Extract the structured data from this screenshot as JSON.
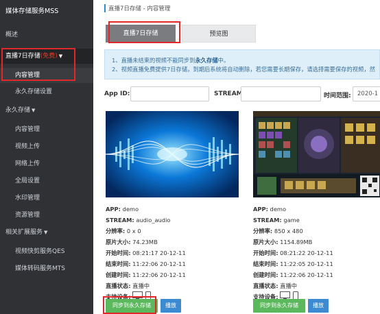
{
  "sidebar": {
    "brand": "媒体存储服务MSS",
    "overview": "概述",
    "live_group": {
      "label": "直播7日存储",
      "badge": "(免费)"
    },
    "content_mgmt": "内容管理",
    "permanent_settings": "永久存储设置",
    "perm_group": "永久存储",
    "perm_items": [
      "内容管理",
      "视频上传",
      "网络上传",
      "全局设置",
      "水印管理",
      "资源管理"
    ],
    "related_group": "相关扩展服务",
    "related_items": [
      "视频快剪服务QES",
      "媒体转码服务MTS"
    ]
  },
  "breadcrumb": "直播7日存储 - 内容管理",
  "tabs": {
    "live": "直播7日存储",
    "preview": "预览图"
  },
  "notice": {
    "line1_prefix": "1、直播未结束的视频不能同步到",
    "line1_bold": "永久存储",
    "line1_suffix": "中。",
    "line2": "2、视频直播免费提供7日存储，到期后系统将自动删除，若您需要长期保存，请选择需要保存的视频，然"
  },
  "filters": {
    "app_id_label": "App ID:",
    "stream_label": "STREAM:",
    "time_label": "时间范围:",
    "time_value": "2020-1"
  },
  "labels": {
    "app": "APP:",
    "stream": "STREAM:",
    "resolution": "分辨率:",
    "size": "原片大小:",
    "start": "开始时间:",
    "end": "结束时间:",
    "created": "创建时间:",
    "status": "直播状态:",
    "devices": "支持设备:"
  },
  "cards": [
    {
      "app": "demo",
      "stream": "audio_audio",
      "resolution": "0 x 0",
      "size": "74.23MB",
      "start": "08:21:17 20-12-11",
      "end": "11:22:06 20-12-11",
      "created": "11:22:06 20-12-11",
      "status": "直播中",
      "sync_label": "同步到永久存储",
      "play_label": "播放"
    },
    {
      "app": "demo",
      "stream": "game",
      "resolution": "850 x 480",
      "size": "1154.89MB",
      "start": "08:21:22 20-12-11",
      "end": "11:22:05 20-12-11",
      "created": "11:22:06 20-12-11",
      "status": "直播中",
      "sync_label": "同步到永久存储",
      "play_label": "播放"
    }
  ],
  "colors": {
    "sidebar_bg": "#2f3135",
    "highlight": "#e0282b",
    "sync_button": "#5cb85c",
    "play_button": "#3b8ad2"
  }
}
